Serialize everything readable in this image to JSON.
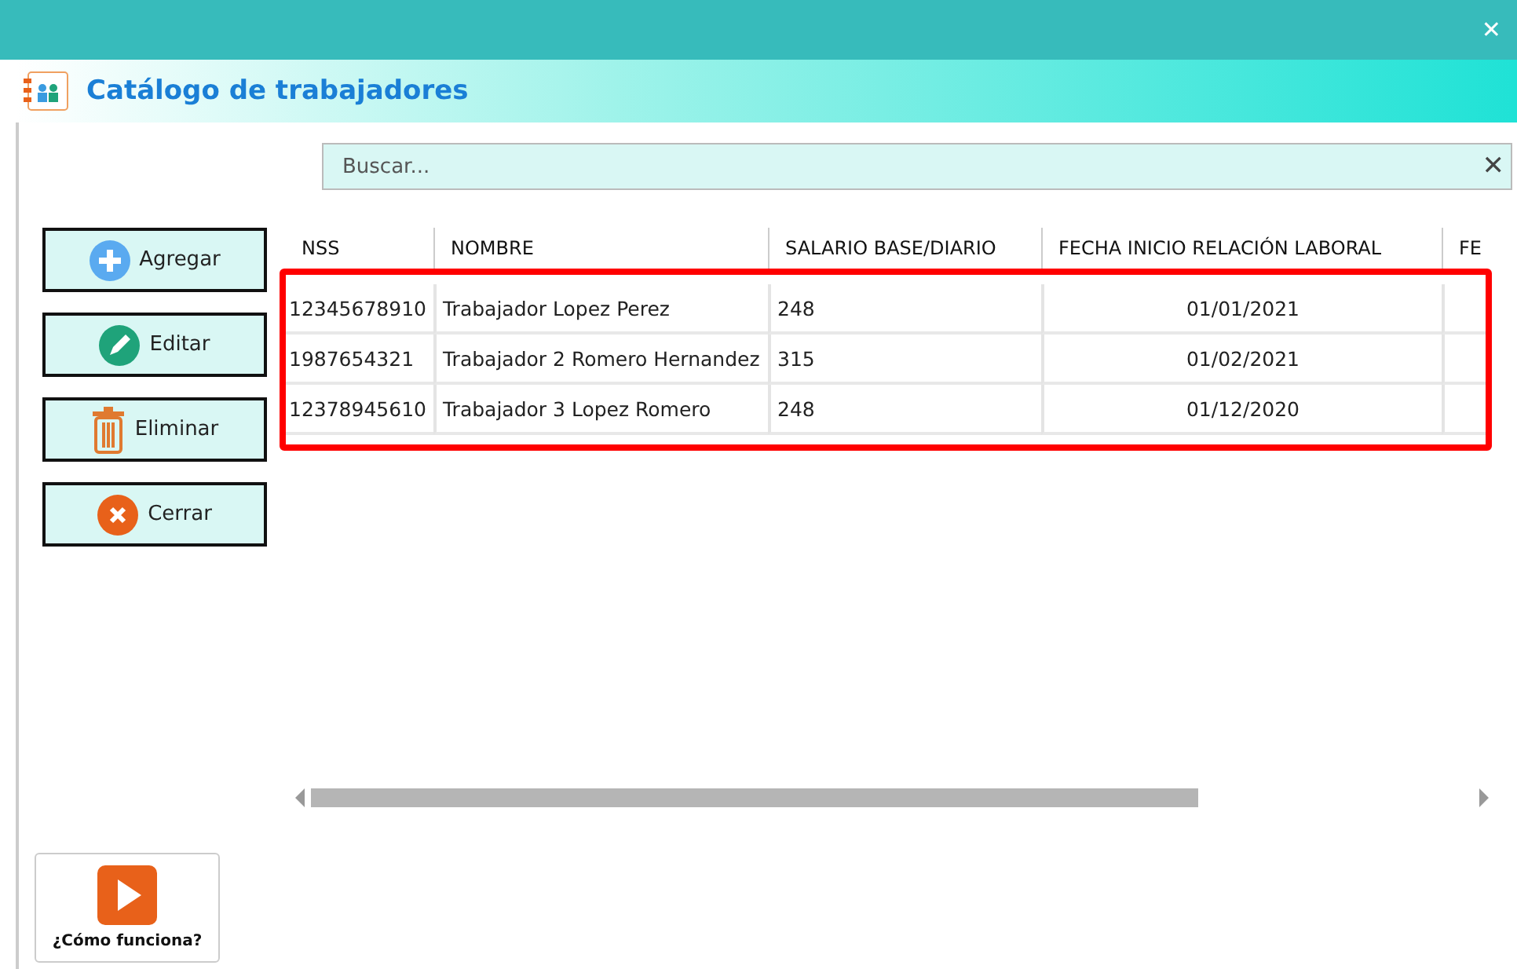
{
  "window": {
    "title": "Catálogo de trabajadores",
    "close": "✕"
  },
  "search": {
    "placeholder": "Buscar...",
    "clear": "✕"
  },
  "buttons": [
    {
      "label": "Agregar",
      "kind": "add"
    },
    {
      "label": "Editar",
      "kind": "edit"
    },
    {
      "label": "Eliminar",
      "kind": "delete"
    },
    {
      "label": "Cerrar",
      "kind": "close"
    }
  ],
  "table": {
    "columns": [
      "NSS",
      "NOMBRE",
      "SALARIO BASE/DIARIO",
      "FECHA INICIO RELACIÓN LABORAL",
      "FE"
    ],
    "rows": [
      [
        "12345678910",
        "Trabajador Lopez Perez",
        "248",
        "01/01/2021",
        ""
      ],
      [
        "1987654321",
        "Trabajador 2 Romero Hernandez",
        "315",
        "01/02/2021",
        ""
      ],
      [
        "12378945610",
        "Trabajador 3 Lopez Romero",
        "248",
        "01/12/2020",
        ""
      ]
    ]
  },
  "help_button": {
    "label": "¿Cómo funciona?"
  }
}
